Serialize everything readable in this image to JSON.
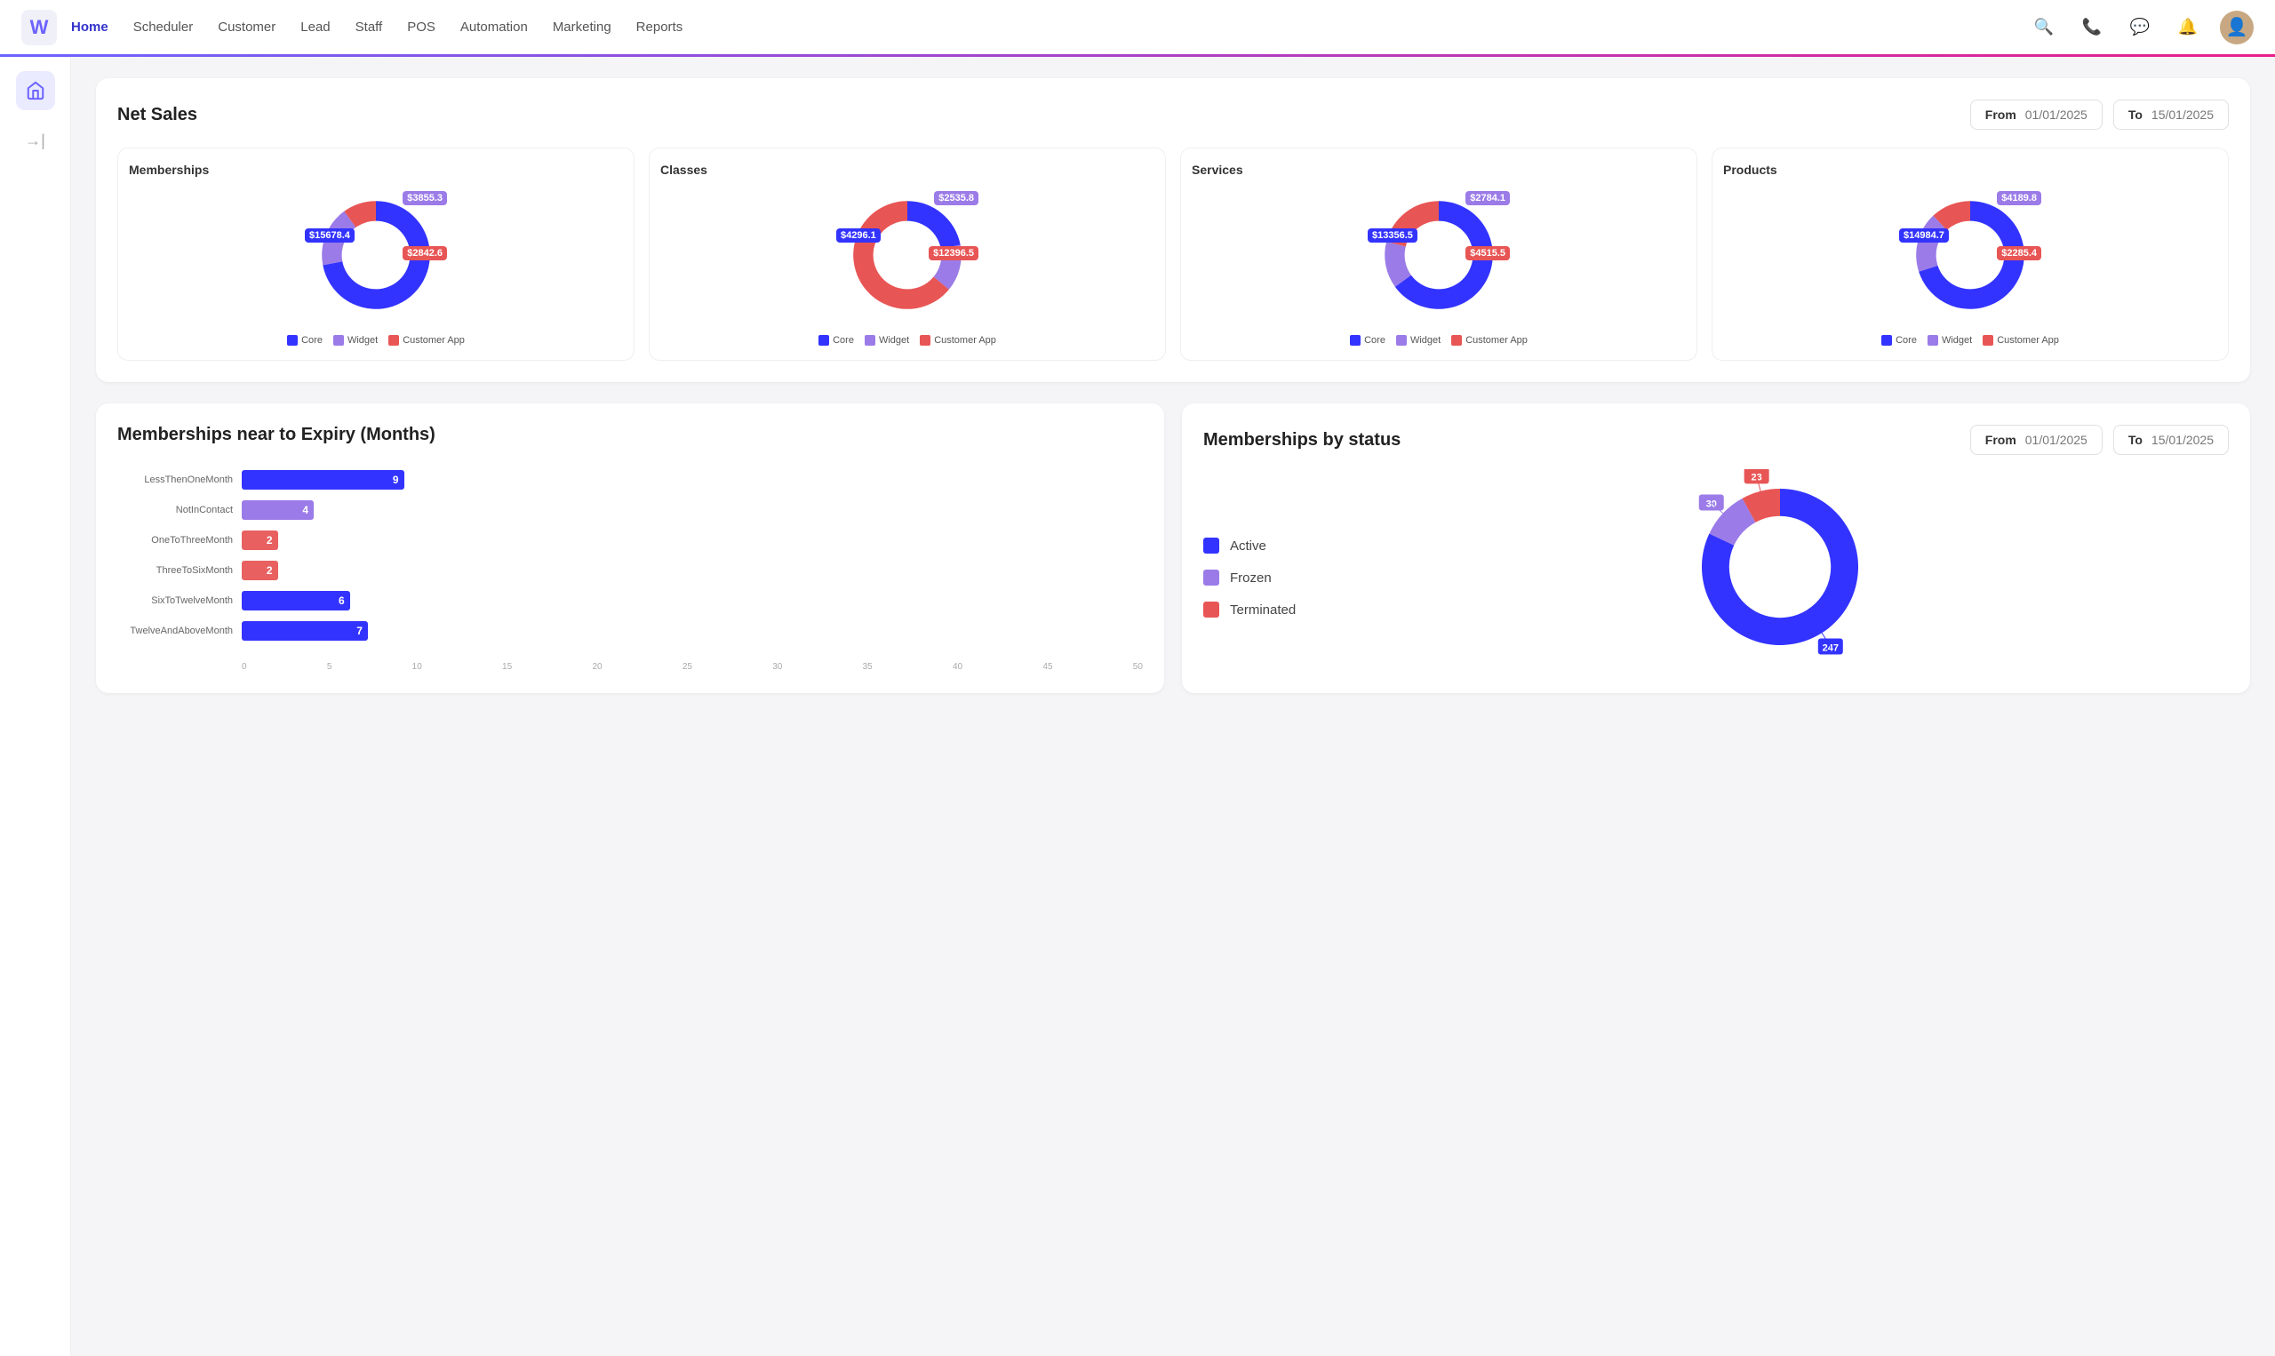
{
  "app": {
    "logo": "W"
  },
  "nav": {
    "links": [
      {
        "label": "Home",
        "active": true
      },
      {
        "label": "Scheduler",
        "active": false
      },
      {
        "label": "Customer",
        "active": false
      },
      {
        "label": "Lead",
        "active": false
      },
      {
        "label": "Staff",
        "active": false
      },
      {
        "label": "POS",
        "active": false
      },
      {
        "label": "Automation",
        "active": false
      },
      {
        "label": "Marketing",
        "active": false
      },
      {
        "label": "Reports",
        "active": false
      }
    ]
  },
  "netSales": {
    "title": "Net Sales",
    "from_label": "From",
    "from_date": "01/01/2025",
    "to_label": "To",
    "to_date": "15/01/2025"
  },
  "charts": [
    {
      "title": "Memberships",
      "core_val": "$15678.4",
      "widget_val": "$3855.3",
      "customer_val": "$2842.6",
      "core_color": "#3333ff",
      "widget_color": "#9b7be8",
      "customer_color": "#e85555",
      "core_pct": 72,
      "widget_pct": 18,
      "customer_pct": 10
    },
    {
      "title": "Classes",
      "core_val": "$4296.1",
      "widget_val": "$2535.8",
      "customer_val": "$12396.5",
      "core_color": "#3333ff",
      "widget_color": "#9b7be8",
      "customer_color": "#e85555",
      "core_pct": 22,
      "widget_pct": 14,
      "customer_pct": 64
    },
    {
      "title": "Services",
      "core_val": "$13356.5",
      "widget_val": "$2784.1",
      "customer_val": "$4515.5",
      "core_color": "#3333ff",
      "widget_color": "#9b7be8",
      "customer_color": "#e85555",
      "core_pct": 65,
      "widget_pct": 14,
      "customer_pct": 21
    },
    {
      "title": "Products",
      "core_val": "$14984.7",
      "widget_val": "$4189.8",
      "customer_val": "$2285.4",
      "core_color": "#3333ff",
      "widget_color": "#9b7be8",
      "customer_color": "#e85555",
      "core_pct": 70,
      "widget_pct": 18,
      "customer_pct": 12
    }
  ],
  "legend": {
    "core": "Core",
    "widget": "Widget",
    "customer_app": "Customer App"
  },
  "expiry": {
    "title": "Memberships near to Expiry (Months)",
    "bars": [
      {
        "label": "LessThenOneMonth",
        "value": 9,
        "color": "#3333ff",
        "pct": 90
      },
      {
        "label": "NotInContact",
        "value": 4,
        "color": "#9b7be8",
        "pct": 40
      },
      {
        "label": "OneToThreeMonth",
        "value": 2,
        "color": "#e86060",
        "pct": 20
      },
      {
        "label": "ThreeToSixMonth",
        "value": 2,
        "color": "#e86060",
        "pct": 20
      },
      {
        "label": "SixToTwelveMonth",
        "value": 6,
        "color": "#3333ff",
        "pct": 60
      },
      {
        "label": "TwelveAndAboveMonth",
        "value": 7,
        "color": "#3333ff",
        "pct": 70
      }
    ],
    "x_axis": [
      "0",
      "5",
      "10",
      "15",
      "20",
      "25",
      "30",
      "35",
      "40",
      "45",
      "50"
    ]
  },
  "membershipStatus": {
    "title": "Memberships by status",
    "from_label": "From",
    "from_date": "01/01/2025",
    "to_label": "To",
    "to_date": "15/01/2025",
    "legend": [
      {
        "label": "Active",
        "color": "#3333ff"
      },
      {
        "label": "Frozen",
        "color": "#9b7be8"
      },
      {
        "label": "Terminated",
        "color": "#e85555"
      }
    ],
    "active_val": "247",
    "frozen_val": "30",
    "terminated_val": "23",
    "active_pct": 82,
    "frozen_pct": 10,
    "terminated_pct": 8
  }
}
